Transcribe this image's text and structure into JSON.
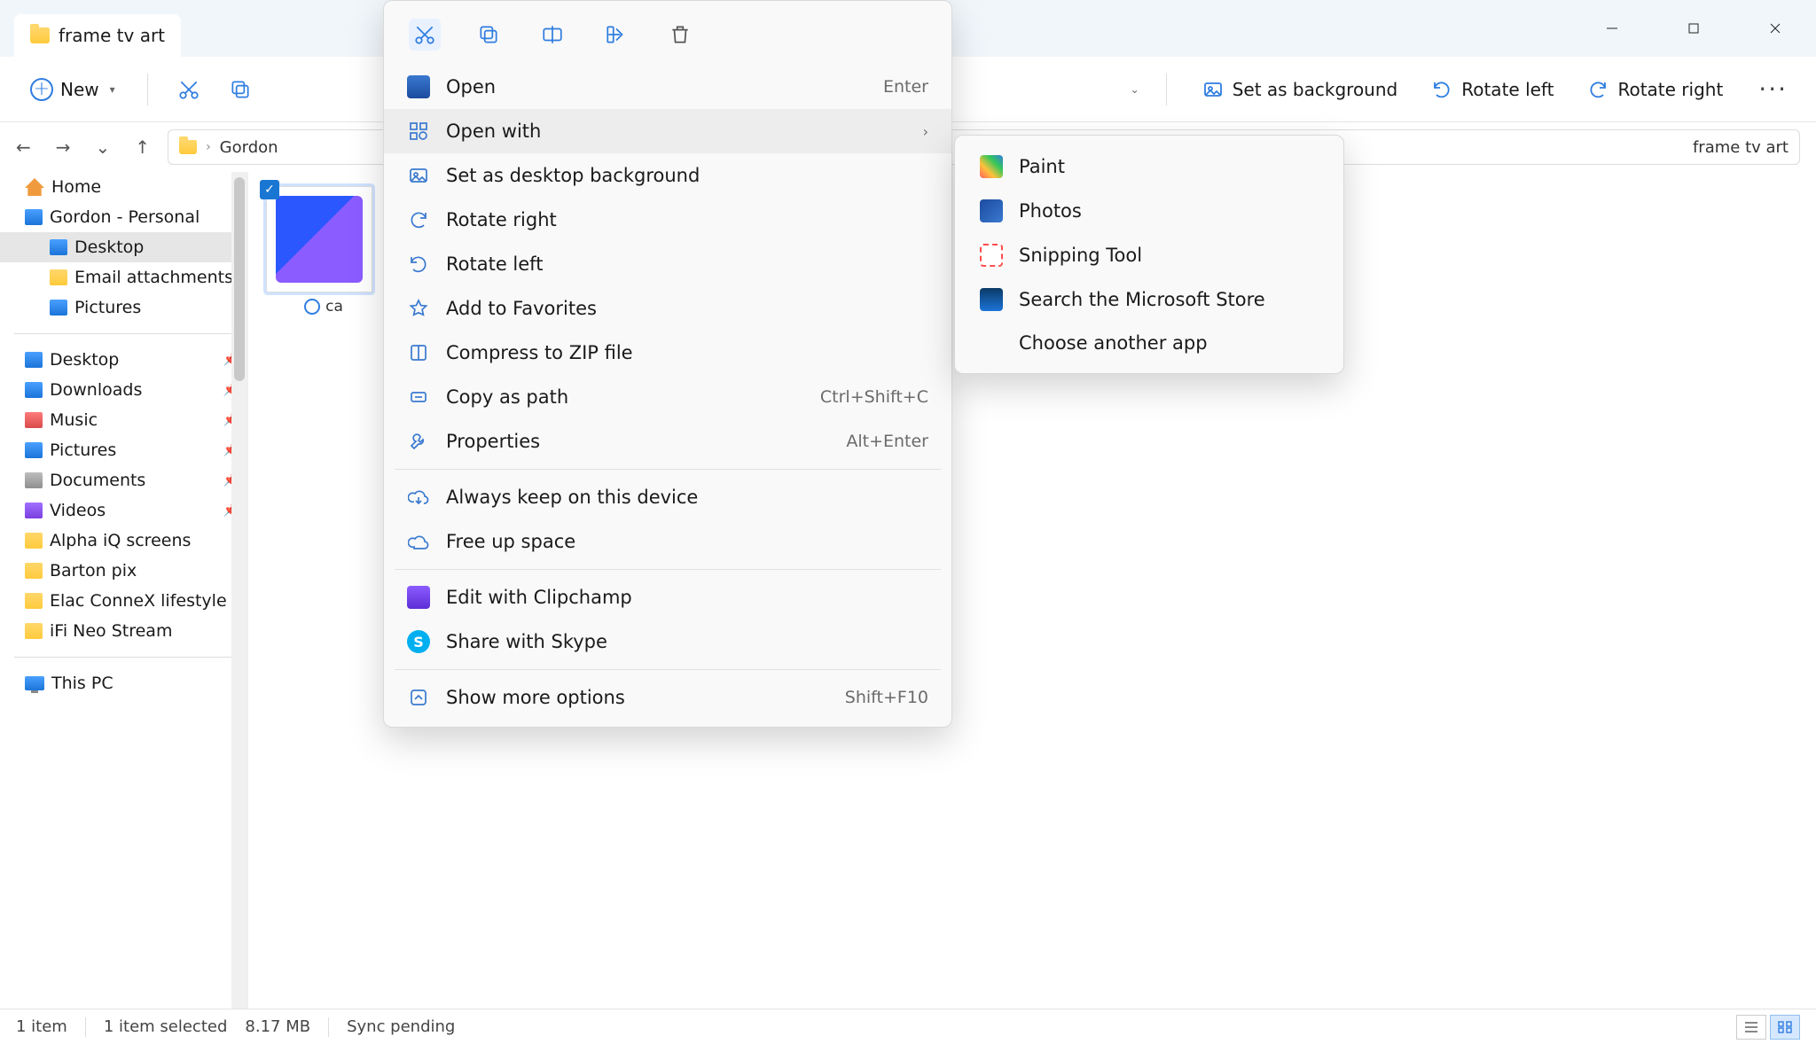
{
  "tab": {
    "title": "frame tv art"
  },
  "window_controls": {
    "minimize": "–",
    "maximize": "▢",
    "close": "✕"
  },
  "commandbar": {
    "new_label": "New",
    "right": {
      "set_bg": "Set as background",
      "rotate_left": "Rotate left",
      "rotate_right": "Rotate right"
    }
  },
  "breadcrumb": {
    "root": "Gordon",
    "tail": "frame tv art"
  },
  "nav": {
    "home": "Home",
    "personal": "Gordon - Personal",
    "desktop": "Desktop",
    "email_attach": "Email attachments",
    "pictures": "Pictures",
    "q_desktop": "Desktop",
    "q_downloads": "Downloads",
    "q_music": "Music",
    "q_pictures": "Pictures",
    "q_documents": "Documents",
    "q_videos": "Videos",
    "f_alpha": "Alpha iQ screens",
    "f_barton": "Barton pix",
    "f_elac": "Elac ConneX lifestyle",
    "f_ifi": "iFi Neo Stream",
    "this_pc": "This PC"
  },
  "file": {
    "caption": "ca"
  },
  "status": {
    "count": "1 item",
    "selection": "1 item selected",
    "size": "8.17 MB",
    "sync": "Sync pending"
  },
  "context": {
    "open": "Open",
    "open_accel": "Enter",
    "open_with": "Open with",
    "set_bg": "Set as desktop background",
    "rotate_right": "Rotate right",
    "rotate_left": "Rotate left",
    "favorites": "Add to Favorites",
    "compress": "Compress to ZIP file",
    "copy_path": "Copy as path",
    "copy_path_accel": "Ctrl+Shift+C",
    "properties": "Properties",
    "properties_accel": "Alt+Enter",
    "keep_device": "Always keep on this device",
    "free_space": "Free up space",
    "clipchamp": "Edit with Clipchamp",
    "skype": "Share with Skype",
    "more": "Show more options",
    "more_accel": "Shift+F10"
  },
  "submenu": {
    "paint": "Paint",
    "photos": "Photos",
    "snip": "Snipping Tool",
    "store": "Search the Microsoft Store",
    "choose": "Choose another app"
  }
}
